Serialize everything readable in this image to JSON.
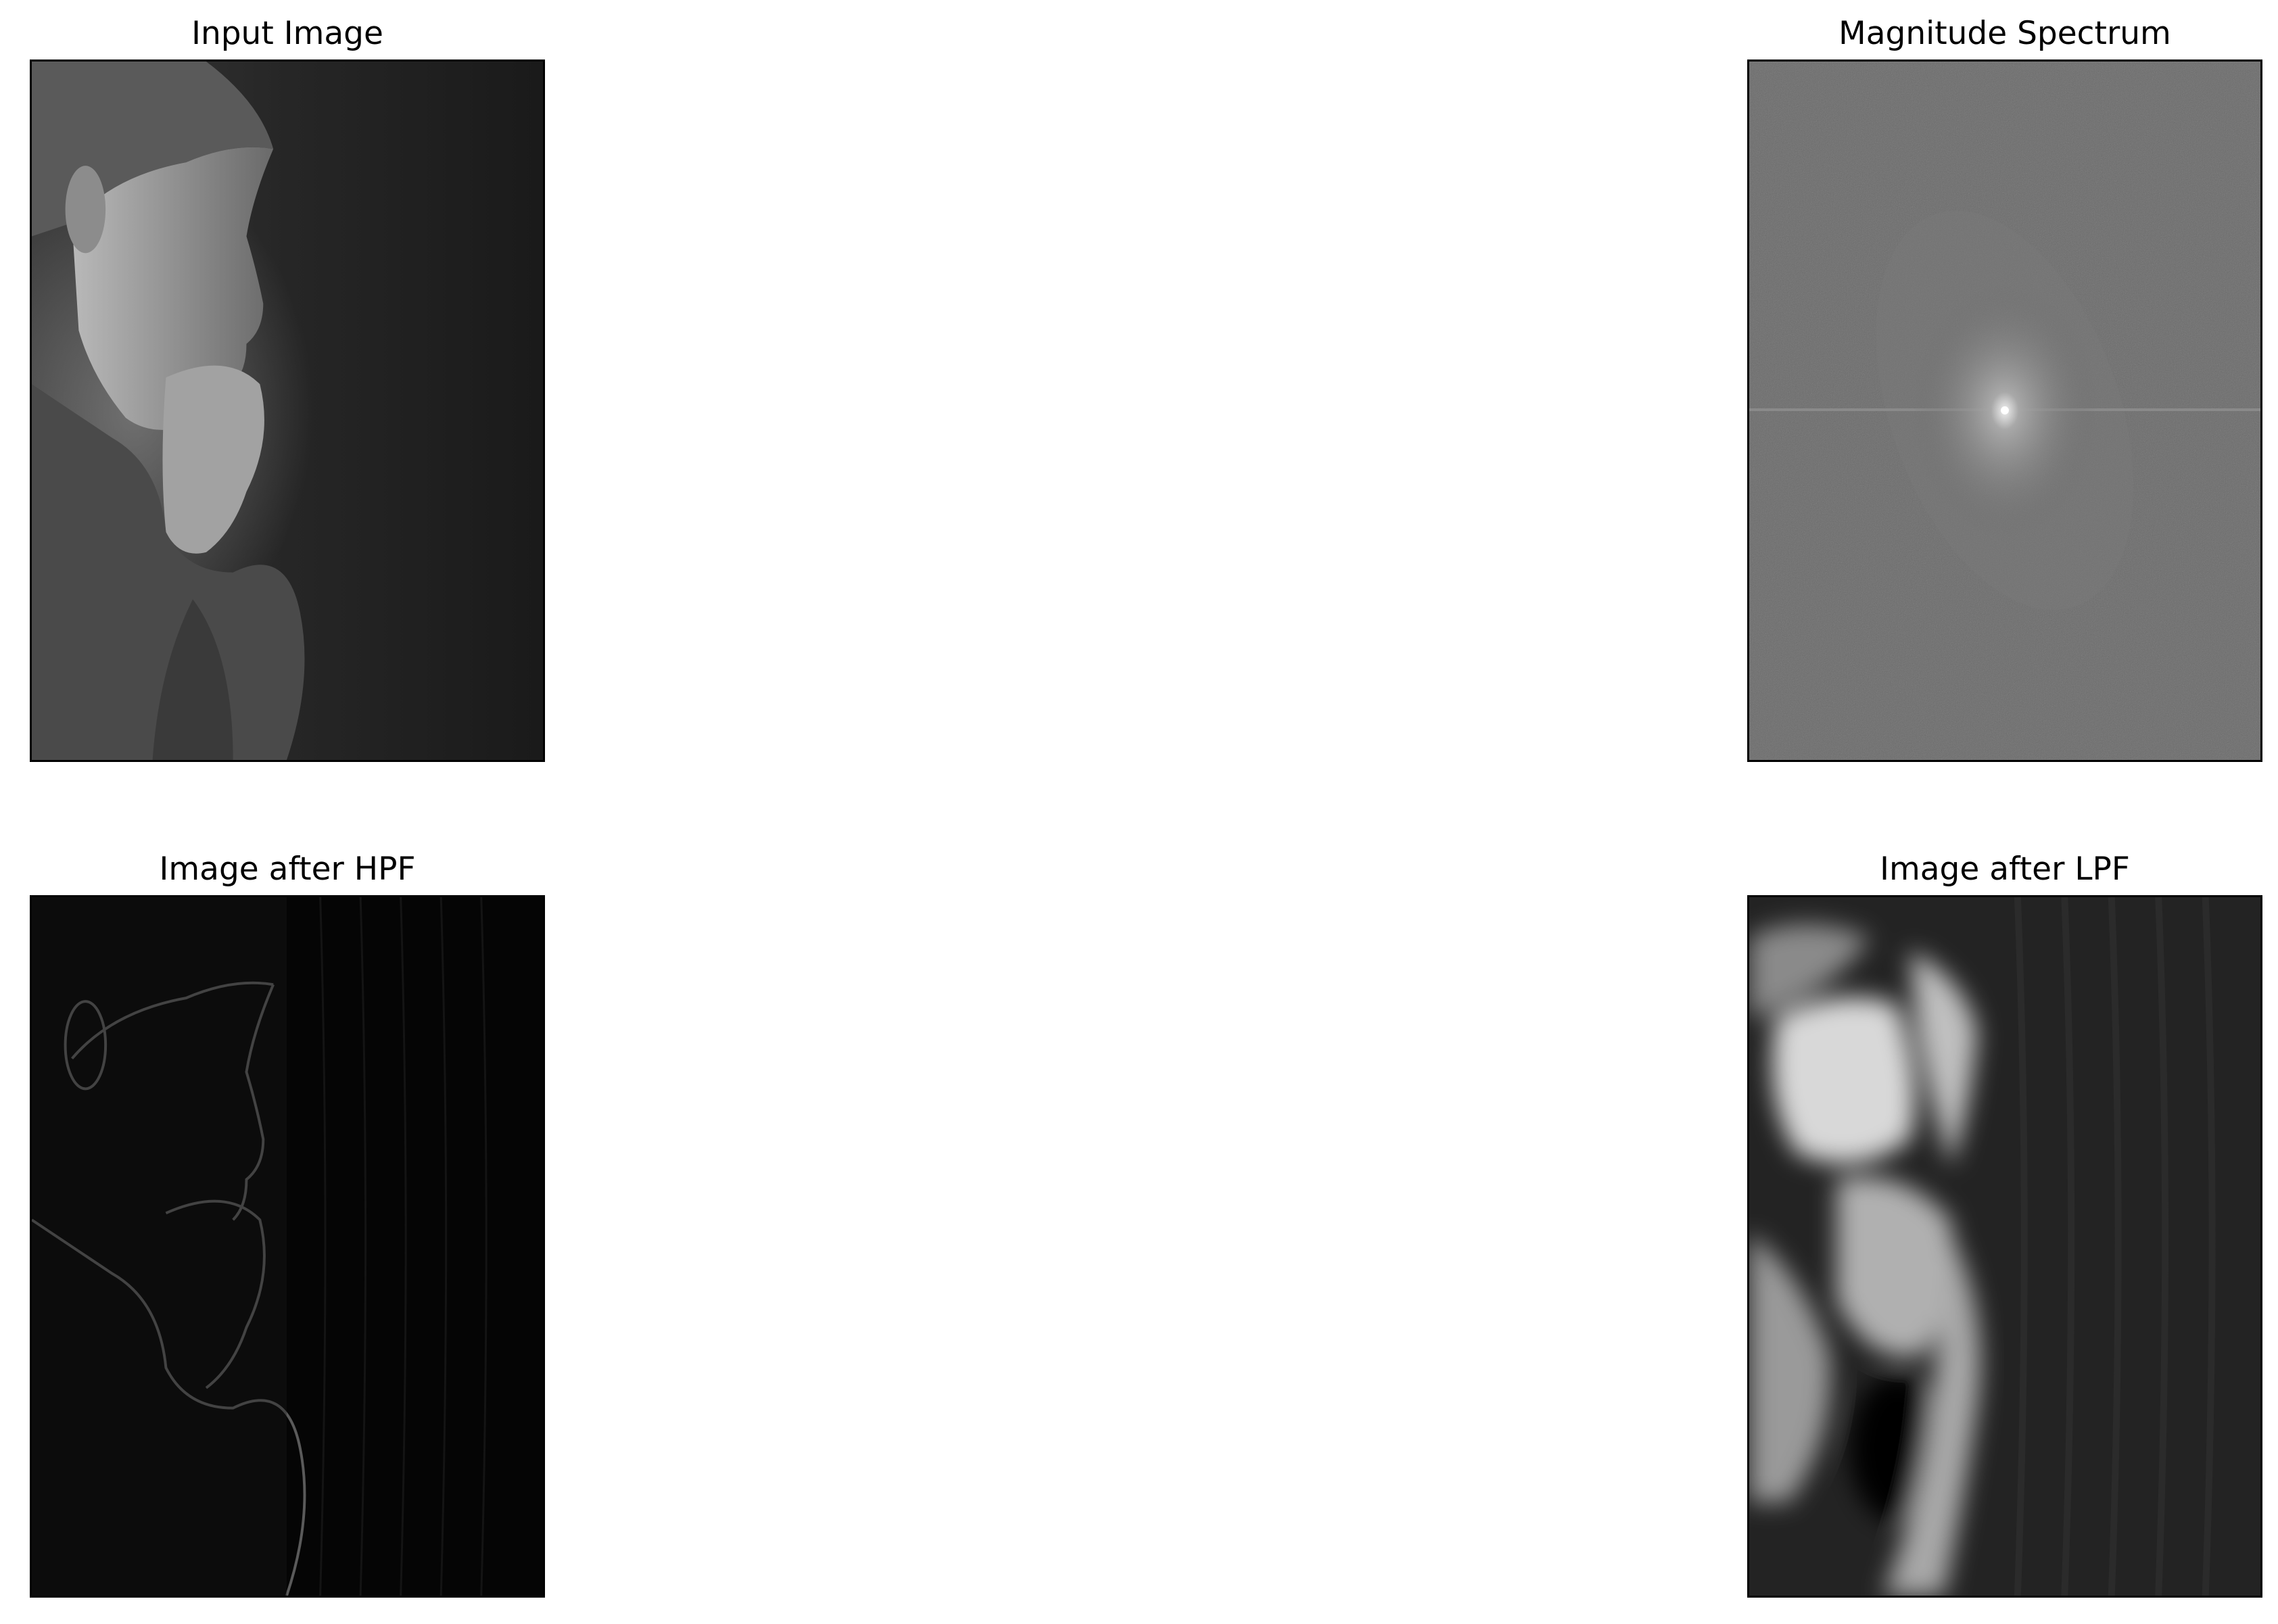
{
  "figure": {
    "panels": [
      {
        "id": "input",
        "title": "Input Image"
      },
      {
        "id": "magnitude",
        "title": "Magnitude Spectrum"
      },
      {
        "id": "hpf",
        "title": "Image after HPF"
      },
      {
        "id": "lpf",
        "title": "Image after LPF"
      }
    ]
  },
  "colors": {
    "background": "#ffffff",
    "frame": "#000000",
    "spectrum_gray": "#6b6b6b",
    "dark_gray": "#1c1c1c"
  }
}
